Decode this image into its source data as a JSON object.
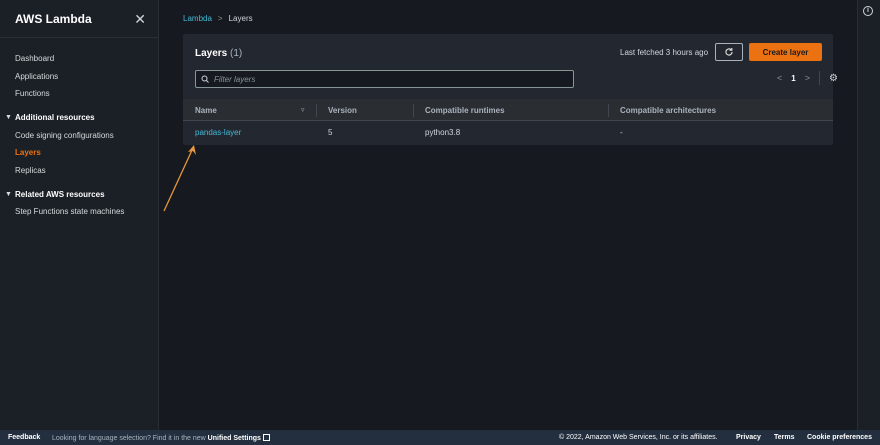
{
  "sidebar": {
    "title": "AWS Lambda",
    "close_glyph": "✕",
    "top_items": [
      {
        "label": "Dashboard"
      },
      {
        "label": "Applications"
      },
      {
        "label": "Functions"
      }
    ],
    "sections": [
      {
        "label": "Additional resources",
        "items": [
          {
            "label": "Code signing configurations"
          },
          {
            "label": "Layers",
            "active": true
          },
          {
            "label": "Replicas"
          }
        ]
      },
      {
        "label": "Related AWS resources",
        "items": [
          {
            "label": "Step Functions state machines"
          }
        ]
      }
    ]
  },
  "breadcrumb": {
    "root": "Lambda",
    "separator": ">",
    "current": "Layers"
  },
  "panel": {
    "title": "Layers",
    "count": "(1)",
    "last_fetched": "Last fetched 3 hours ago",
    "create_button": "Create layer",
    "filter_placeholder": "Filter layers",
    "page_number": "1",
    "columns": [
      "Name",
      "Version",
      "Compatible runtimes",
      "Compatible architectures"
    ],
    "rows": [
      {
        "name": "pandas-layer",
        "version": "5",
        "runtimes": "python3.8",
        "architectures": "-"
      }
    ]
  },
  "footer": {
    "feedback": "Feedback",
    "language_prefix": "Looking for language selection? Find it in the new",
    "language_link": "Unified Settings",
    "copyright": "© 2022, Amazon Web Services, Inc. or its affiliates.",
    "privacy": "Privacy",
    "terms": "Terms",
    "cookies": "Cookie preferences"
  },
  "colors": {
    "accent": "#ec7211",
    "link": "#44b9d6",
    "background": "#16191f",
    "annotation_arrow": "#e8973a"
  },
  "icons": {
    "close": "close-icon",
    "info": "info-icon",
    "refresh": "refresh-icon",
    "search": "search-icon",
    "settings": "gear-icon"
  }
}
